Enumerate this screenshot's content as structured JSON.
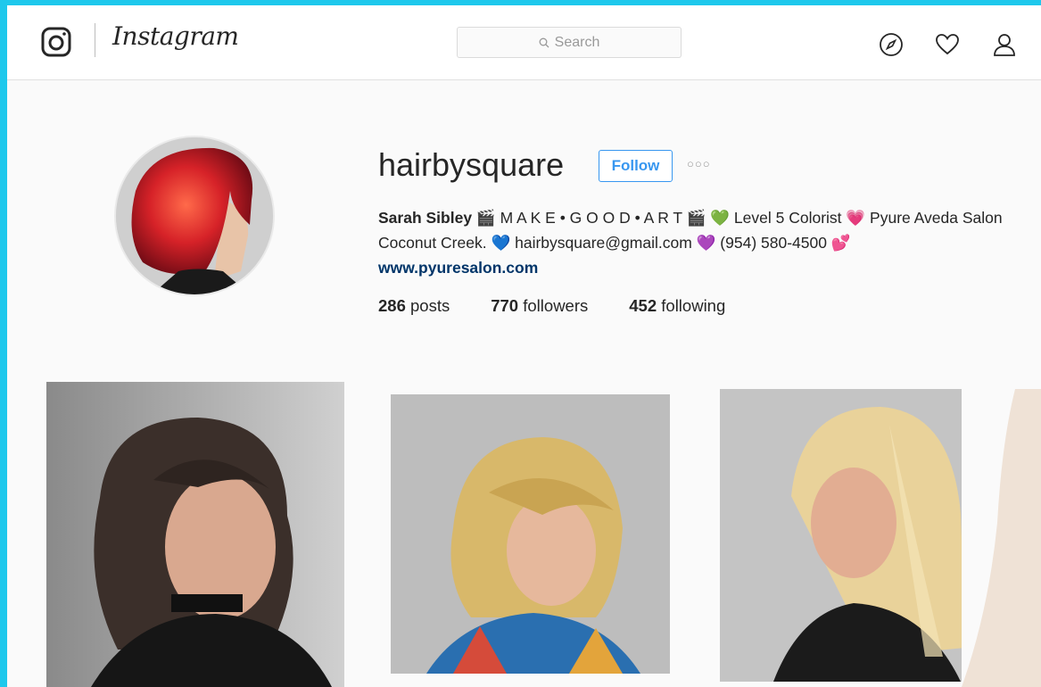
{
  "brand": {
    "wordmark": "Instagram",
    "logo_icon": "instagram-camera-icon"
  },
  "search": {
    "placeholder": "Search",
    "icon": "search-icon"
  },
  "nav_icons": [
    "compass-icon",
    "heart-icon",
    "profile-icon"
  ],
  "profile": {
    "username": "hairbysquare",
    "follow_label": "Follow",
    "more_label": "○○○",
    "bio": {
      "name": "Sarah Sibley",
      "seg1": " 🎬 M A K E • G O O D • A R T 🎬 💚 Level 5 Colorist 💗 Pyure Aveda Salon Coconut Creek. 💙 hairbysquare@gmail.com 💜 (954) 580-4500 💕",
      "link": "www.pyuresalon.com"
    },
    "stats": {
      "posts_count": "286",
      "posts_label": "posts",
      "followers_count": "770",
      "followers_label": "followers",
      "following_count": "452",
      "following_label": "following"
    }
  },
  "colors": {
    "accent": "#3897f0",
    "link": "#003569",
    "outer_border": "#1ec8ec"
  }
}
